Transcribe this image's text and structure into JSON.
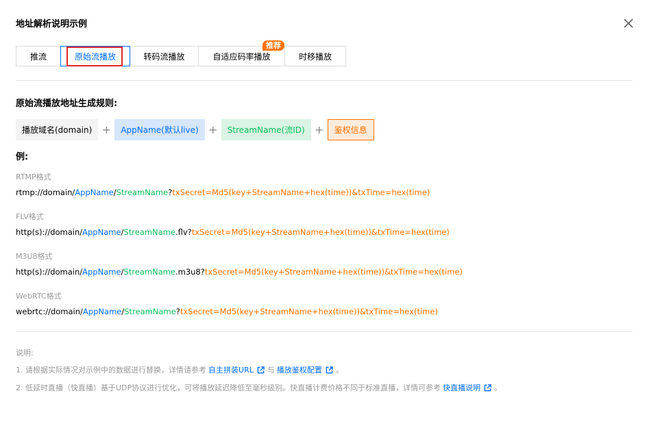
{
  "dialog": {
    "title": "地址解析说明示例"
  },
  "tabs": [
    {
      "label": "推流"
    },
    {
      "label": "原始流播放"
    },
    {
      "label": "转码流播放"
    },
    {
      "label": "自适应码率播放",
      "badge": "推荐"
    },
    {
      "label": "时移播放"
    }
  ],
  "rule": {
    "title": "原始流播放地址生成规则:",
    "domain": "播放域名(domain)",
    "app": "AppName(默认live)",
    "stream": "StreamName(流ID)",
    "auth": "鉴权信息",
    "plus": "+"
  },
  "examples": {
    "label": "例:",
    "items": [
      {
        "format": "RTMP格式",
        "prefix": "rtmp://domain/",
        "app": "AppName",
        "sep": "/",
        "stream": "StreamName",
        "ext": "?",
        "query": "txSecret=Md5(key+StreamName+hex(time))&txTime=hex(time)"
      },
      {
        "format": "FLV格式",
        "prefix": "http(s)://domain/",
        "app": "AppName",
        "sep": "/",
        "stream": "StreamName",
        "ext": ".flv?",
        "query": "txSecret=Md5(key+StreamName+hex(time))&txTime=hex(time)"
      },
      {
        "format": "M3U8格式",
        "prefix": "http(s)://domain/",
        "app": "AppName",
        "sep": "/",
        "stream": "StreamName",
        "ext": ".m3u8?",
        "query": "txSecret=Md5(key+StreamName+hex(time))&txTime=hex(time)"
      },
      {
        "format": "WebRTC格式",
        "prefix": "webrtc://domain/",
        "app": "AppName",
        "sep": "/",
        "stream": "StreamName",
        "ext": "?",
        "query": "txSecret=Md5(key+StreamName+hex(time))&txTime=hex(time)"
      }
    ]
  },
  "notes": {
    "title": "说明:",
    "note1": {
      "text_before": "1. 请根据实际情况对示例中的数据进行替换，详情请参考",
      "link1": "自主拼装URL",
      "middle": "与",
      "link2": "播放鉴权配置",
      "end": "。"
    },
    "note2": {
      "text_before": "2. 低延时直播（快直播）基于UDP协议进行优化，可将播放延迟降低至毫秒级别。快直播计费价格不同于标准直播，详情可参考",
      "link": "快直播说明",
      "end": "。"
    }
  },
  "colors": {
    "accent_blue": "#006eff",
    "green": "#0abf5b",
    "orange": "#ff7200",
    "highlight_red": "#e0262b"
  }
}
